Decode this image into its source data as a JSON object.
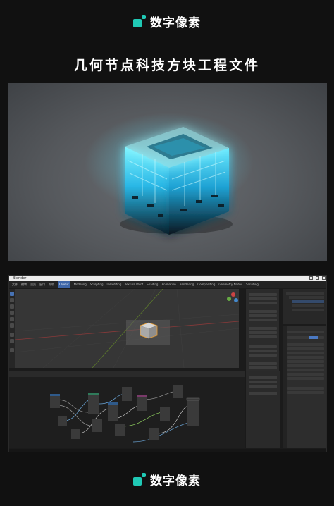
{
  "brand": {
    "name": "数字像素"
  },
  "headline": "几何节点科技方块工程文件",
  "blender": {
    "window_title": "Blender",
    "menus": [
      "文件",
      "编辑",
      "渲染",
      "窗口",
      "帮助"
    ],
    "workspaces": [
      "Layout",
      "Modeling",
      "Sculpting",
      "UV Editing",
      "Texture Paint",
      "Shading",
      "Animation",
      "Rendering",
      "Compositing",
      "Geometry Nodes",
      "Scripting"
    ],
    "active_workspace": "Layout"
  },
  "colors": {
    "background": "#111111",
    "brand_accent": "#20c9b5",
    "glow": "#3fe6ff",
    "blender_active": "#4772b3"
  }
}
